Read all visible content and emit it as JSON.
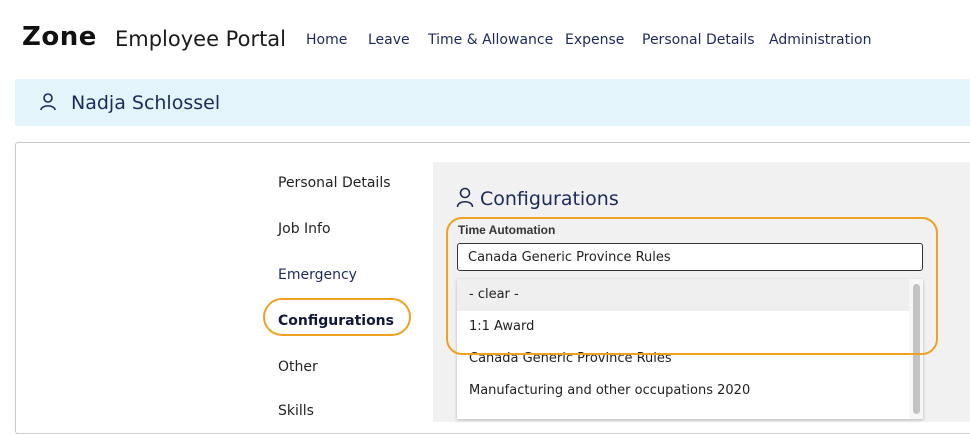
{
  "header": {
    "logo_brand": "Zone",
    "logo_product": "Employee Portal",
    "nav": [
      {
        "label": "Home"
      },
      {
        "label": "Leave"
      },
      {
        "label": "Time & Allowance"
      },
      {
        "label": "Expense"
      },
      {
        "label": "Personal Details"
      },
      {
        "label": "Administration"
      }
    ]
  },
  "banner": {
    "user_icon": "user-icon",
    "employee_name": "Nadja Schlossel"
  },
  "sidebar": {
    "items": [
      {
        "label": "Personal Details",
        "state": "default"
      },
      {
        "label": "Job Info",
        "state": "default"
      },
      {
        "label": "Emergency",
        "state": "link"
      },
      {
        "label": "Configurations",
        "state": "active"
      },
      {
        "label": "Other",
        "state": "default"
      },
      {
        "label": "Skills",
        "state": "default"
      }
    ]
  },
  "main": {
    "title_icon": "user-icon",
    "title": "Configurations",
    "time_automation": {
      "label": "Time Automation",
      "value": "Canada Generic Province Rules",
      "options": [
        {
          "label": "- clear -",
          "hovered": true
        },
        {
          "label": "1:1 Award"
        },
        {
          "label": "Canada Generic Province Rules"
        },
        {
          "label": "Manufacturing and other occupations 2020"
        }
      ]
    }
  },
  "colors": {
    "highlight": "#f0a022",
    "banner_bg": "#e3f4fa",
    "nav_text": "#1c2a5a"
  }
}
